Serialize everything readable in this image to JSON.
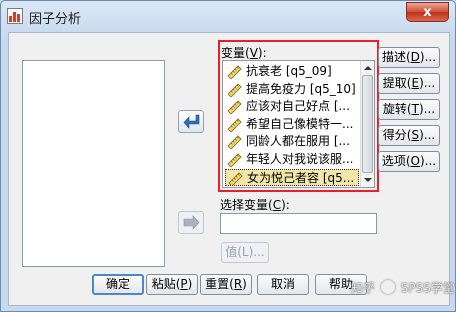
{
  "window": {
    "title": "因子分析",
    "close_label": "x"
  },
  "variables": {
    "label_pre": "变量(",
    "label_key": "V",
    "label_post": "):",
    "items": [
      "抗衰老 [q5_09]",
      "提高免疫力 [q5_10]",
      "应该对自己好点 [...",
      "希望自己像模特一...",
      "同龄人都在服用 [...",
      "年轻人对我说该服...",
      "女为悦己者容 [q5..."
    ],
    "selected_index": 6
  },
  "selection": {
    "label_pre": "选择变量(",
    "label_key": "C",
    "label_post": "):",
    "value": "",
    "value_button": "值(L)..."
  },
  "side_buttons": [
    {
      "pre": "描述(",
      "key": "D",
      "post": ")..."
    },
    {
      "pre": "提取(",
      "key": "E",
      "post": ")..."
    },
    {
      "pre": "旋转(",
      "key": "T",
      "post": ")..."
    },
    {
      "pre": "得分(",
      "key": "S",
      "post": ")..."
    },
    {
      "pre": "选项(",
      "key": "O",
      "post": ")..."
    }
  ],
  "bottom_buttons": [
    {
      "pre": "确定",
      "key": "",
      "post": ""
    },
    {
      "pre": "粘贴(",
      "key": "P",
      "post": ")"
    },
    {
      "pre": "重置(",
      "key": "R",
      "post": ")"
    },
    {
      "pre": "取消",
      "key": "",
      "post": ""
    },
    {
      "pre": "帮助",
      "key": "",
      "post": ""
    }
  ],
  "watermark": {
    "text_left": "知乎 ",
    "text_right": " SPSS学堂"
  },
  "colors": {
    "highlight_border": "#e8202a",
    "selected_item_bg": "#f2e6a8",
    "arrow_blue": "#2f6fb6"
  }
}
